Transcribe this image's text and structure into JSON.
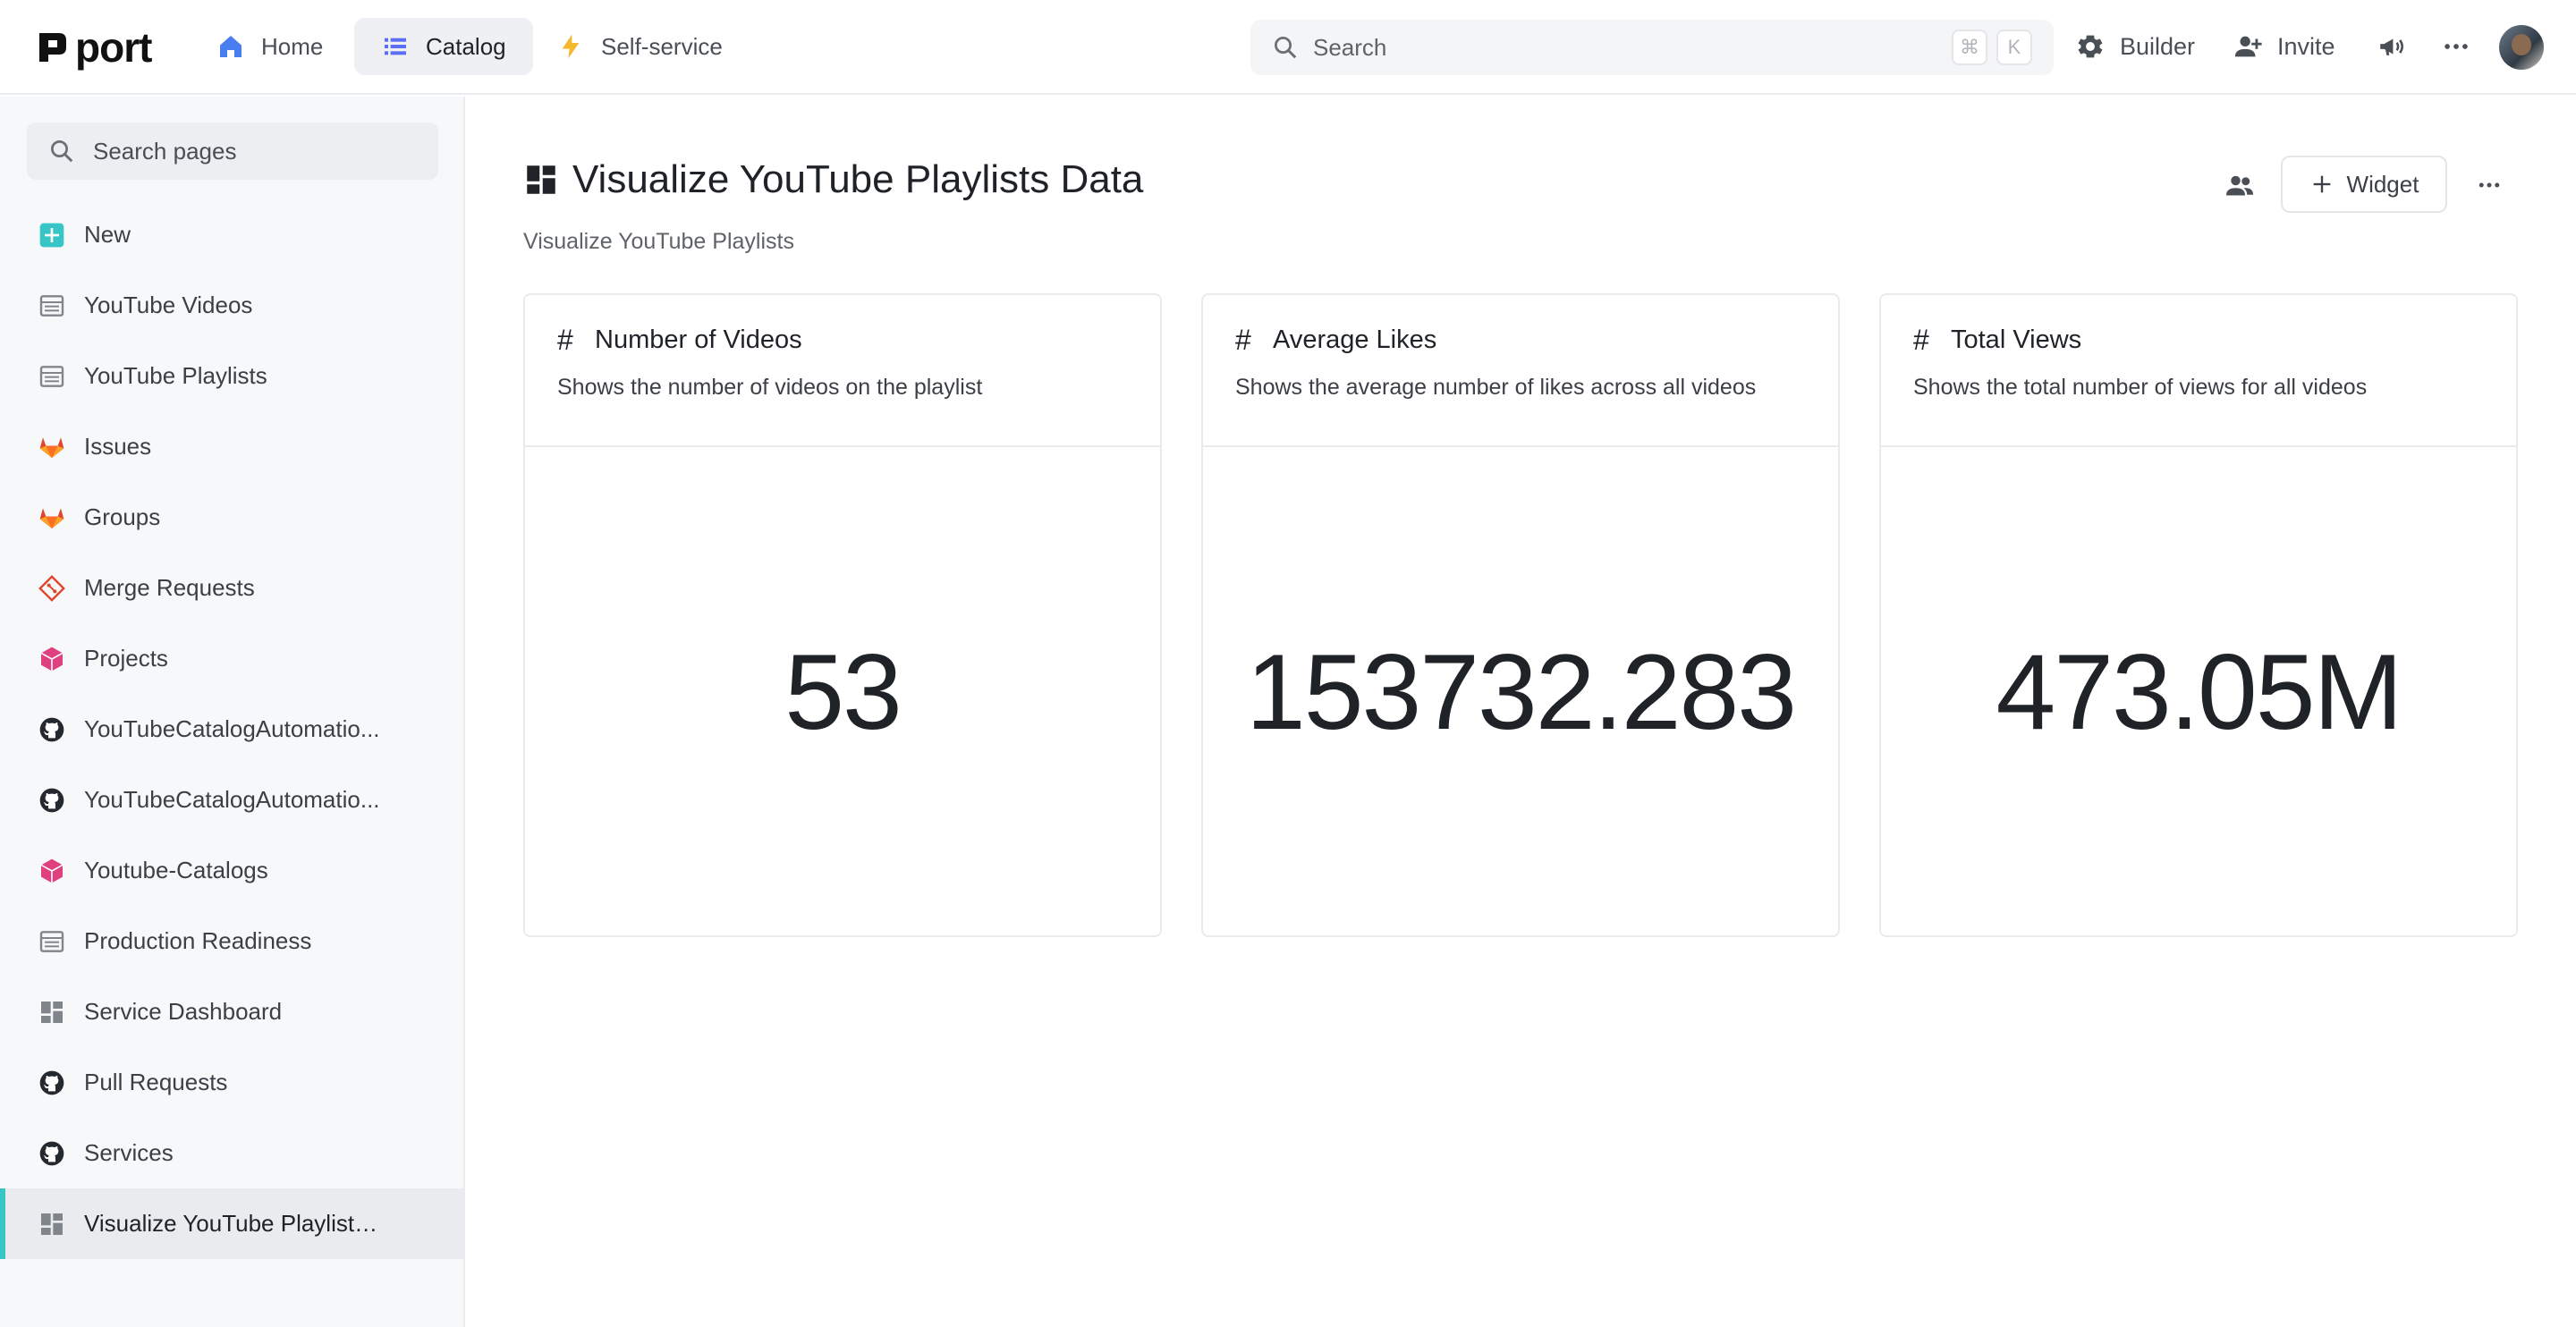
{
  "app": {
    "logo_text": "port"
  },
  "nav": [
    {
      "label": "Home",
      "icon": "home-icon"
    },
    {
      "label": "Catalog",
      "icon": "catalog-list-icon",
      "active": true
    },
    {
      "label": "Self-service",
      "icon": "lightning-icon"
    }
  ],
  "search": {
    "placeholder": "Search",
    "shortcut_mod": "⌘",
    "shortcut_key": "K"
  },
  "topbar": {
    "builder_label": "Builder",
    "invite_label": "Invite"
  },
  "sidebar": {
    "search_placeholder": "Search pages",
    "items": [
      {
        "label": "New",
        "icon": "plus-square-icon"
      },
      {
        "label": "YouTube Videos",
        "icon": "table-icon"
      },
      {
        "label": "YouTube Playlists",
        "icon": "table-icon"
      },
      {
        "label": "Issues",
        "icon": "gitlab-icon"
      },
      {
        "label": "Groups",
        "icon": "gitlab-icon"
      },
      {
        "label": "Merge Requests",
        "icon": "merge-request-icon"
      },
      {
        "label": "Projects",
        "icon": "cube-icon"
      },
      {
        "label": "YouTubeCatalogAutomatio...",
        "icon": "github-icon"
      },
      {
        "label": "YouTubeCatalogAutomatio...",
        "icon": "github-icon"
      },
      {
        "label": "Youtube-Catalogs",
        "icon": "cube-icon"
      },
      {
        "label": "Production Readiness",
        "icon": "table-icon"
      },
      {
        "label": "Service Dashboard",
        "icon": "dashboard-icon"
      },
      {
        "label": "Pull Requests",
        "icon": "github-icon"
      },
      {
        "label": "Services",
        "icon": "github-icon"
      },
      {
        "label": "Visualize YouTube Playlists ...",
        "icon": "dashboard-icon",
        "active": true
      }
    ]
  },
  "page": {
    "title": "Visualize YouTube Playlists Data",
    "subtitle": "Visualize YouTube Playlists",
    "widget_button_label": "Widget"
  },
  "widgets": [
    {
      "title": "Number of Videos",
      "description": "Shows the number of videos on the playlist",
      "value": "53"
    },
    {
      "title": "Average Likes",
      "description": "Shows the average number of likes across all videos",
      "value": "153732.283"
    },
    {
      "title": "Total Views",
      "description": "Shows the total number of views for all videos",
      "value": "473.05M"
    }
  ],
  "colors": {
    "accent": "#38c5c6",
    "catalog_icon": "#5b6ef5",
    "home_icon": "#4a7df0",
    "lightning": "#f5b82e",
    "gitlab": "#e2432a",
    "cube": "#e0407f"
  }
}
